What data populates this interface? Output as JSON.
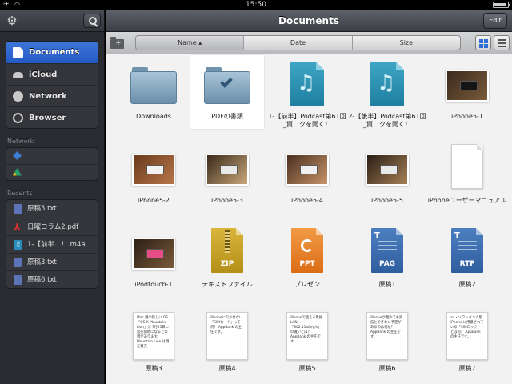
{
  "status": {
    "time": "15:50"
  },
  "sidebar": {
    "nav": [
      {
        "label": "Documents",
        "icon": "document-icon",
        "active": true
      },
      {
        "label": "iCloud",
        "icon": "cloud-icon"
      },
      {
        "label": "Network",
        "icon": "network-icon"
      },
      {
        "label": "Browser",
        "icon": "compass-icon"
      }
    ],
    "network_label": "Network",
    "network_items": [
      {
        "icon": "dropbox-icon"
      },
      {
        "icon": "google-drive-icon"
      }
    ],
    "recents_label": "Recents",
    "recents": [
      {
        "label": "原稿5.txt",
        "icon": "text-file-icon"
      },
      {
        "label": "日曜コラム2.pdf",
        "icon": "pdf-icon"
      },
      {
        "label": "1-【前半…！.m4a",
        "icon": "audio-file-icon"
      },
      {
        "label": "原稿3.txt",
        "icon": "text-file-icon"
      },
      {
        "label": "原稿6.txt",
        "icon": "text-file-icon"
      }
    ]
  },
  "header": {
    "title": "Documents",
    "edit_label": "Edit"
  },
  "toolbar": {
    "sort": [
      "Name ▴",
      "Date",
      "Size"
    ]
  },
  "files": [
    {
      "label": "Downloads",
      "kind": "folder"
    },
    {
      "label": "PDFの書類",
      "kind": "folder-checked",
      "selected": true
    },
    {
      "label": "1-【前半】Podcast第61回_資…クを聞く！",
      "kind": "audio"
    },
    {
      "label": "2-【後半】Podcast第61回_資…クを聞く！",
      "kind": "audio"
    },
    {
      "label": "iPhone5-1",
      "kind": "photo",
      "colors": [
        "#3a2a1e",
        "#7a5a3a",
        "#151515"
      ]
    },
    {
      "label": "iPhone5-2",
      "kind": "photo",
      "colors": [
        "#6a3a1c",
        "#b7754a",
        "#f2f2f2"
      ]
    },
    {
      "label": "iPhone5-3",
      "kind": "photo",
      "colors": [
        "#3a2a1a",
        "#c9a77a",
        "#e8e8e8"
      ]
    },
    {
      "label": "iPhone5-4",
      "kind": "photo",
      "colors": [
        "#4a3020",
        "#c79468",
        "#f0f0f0"
      ]
    },
    {
      "label": "iPhone5-5",
      "kind": "photo",
      "colors": [
        "#2a1e14",
        "#a68056",
        "#e9e9e9"
      ]
    },
    {
      "label": "iPhoneユーザーマニュアル",
      "kind": "blank"
    },
    {
      "label": "iPodtouch-1",
      "kind": "photo",
      "colors": [
        "#2a1e14",
        "#7a5a3a",
        "#e64d86"
      ]
    },
    {
      "label": "テキストファイル",
      "kind": "zip",
      "tag": "ZIP"
    },
    {
      "label": "プレゼン",
      "kind": "ppt",
      "tag": "PPT"
    },
    {
      "label": "原稿1",
      "kind": "pag",
      "tag": "PAG"
    },
    {
      "label": "原稿2",
      "kind": "rtf",
      "tag": "RTF"
    },
    {
      "label": "原稿3",
      "kind": "text",
      "preview": "Mac 用の新しい OS「OS X Mountain Lion」が 7月25日に発売開始になるとの噂があります。Mountain Lion は現在発売"
    },
    {
      "label": "原稿4",
      "kind": "text",
      "preview": "iPhoneに欠かせない「SIMカード」って何？ AppBank の主任です。"
    },
    {
      "label": "原稿5",
      "kind": "text",
      "preview": "iPhoneで使える無線LAN「802.11a/b/g/n」の違いとは？ AppBank の主任です。"
    },
    {
      "label": "原稿6",
      "kind": "text",
      "preview": "iPhoneが圏外でも受信とできない予定があるのは何故？ AppBank の主任です。"
    },
    {
      "label": "原稿7",
      "kind": "text",
      "preview": "au・ソフトバンク版iPhone に用意されている「SIMロック」とは何？ AppBank の主任です。"
    }
  ]
}
